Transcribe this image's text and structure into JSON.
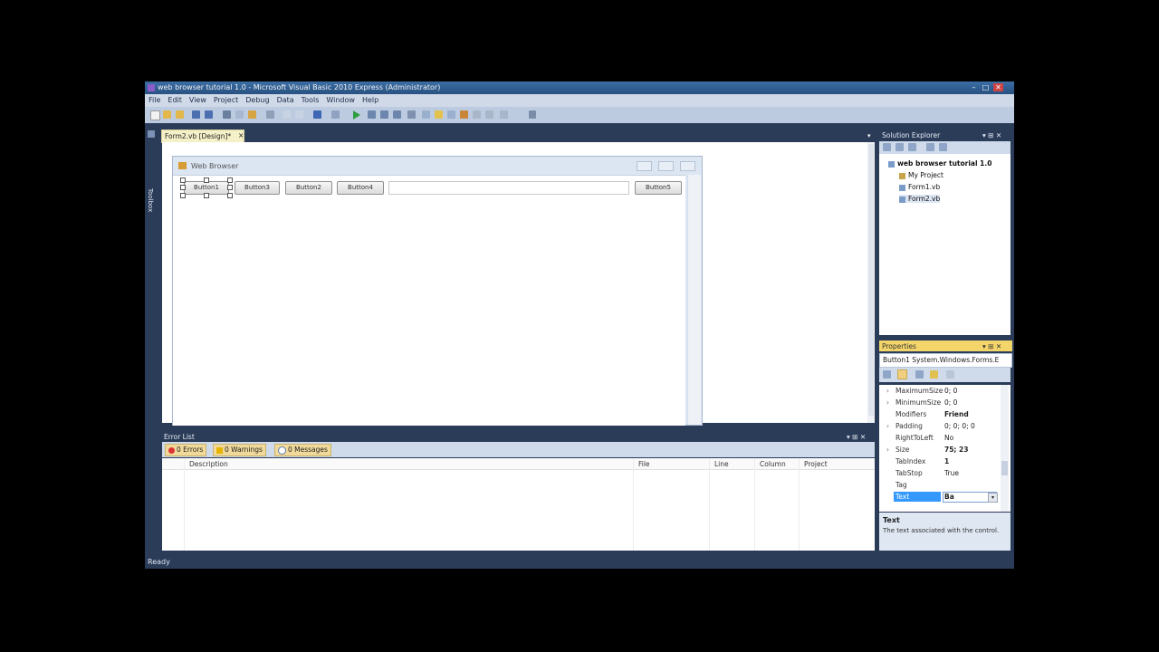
{
  "window": {
    "title": "web browser tutorial 1.0 - Microsoft Visual Basic 2010 Express (Administrator)",
    "minimize": "–",
    "maximize": "□",
    "close": "✕"
  },
  "menu": [
    "File",
    "Edit",
    "View",
    "Project",
    "Debug",
    "Data",
    "Tools",
    "Window",
    "Help"
  ],
  "toolbox": {
    "label": "Toolbox"
  },
  "designer": {
    "tab_label": "Form2.vb [Design]*",
    "tab_close": "×",
    "dropdown": "▾",
    "form": {
      "caption": "Web Browser",
      "buttons": [
        "Button1",
        "Button3",
        "Button2",
        "Button4",
        "Button5"
      ]
    }
  },
  "solution_explorer": {
    "title": "Solution Explorer",
    "pin": "▾ ⊞ ✕",
    "solution": "web browser tutorial 1.0",
    "items": [
      "My Project",
      "Form1.vb",
      "Form2.vb"
    ]
  },
  "properties": {
    "title": "Properties",
    "pin": "▾ ⊞ ✕",
    "object": "Button1 System.Windows.Forms.E",
    "rows": [
      {
        "name": "MaximumSize",
        "value": "0; 0",
        "expandable": true
      },
      {
        "name": "MinimumSize",
        "value": "0; 0",
        "expandable": true
      },
      {
        "name": "Modifiers",
        "value": "Friend",
        "bold": true
      },
      {
        "name": "Padding",
        "value": "0; 0; 0; 0",
        "expandable": true
      },
      {
        "name": "RightToLeft",
        "value": "No"
      },
      {
        "name": "Size",
        "value": "75; 23",
        "expandable": true,
        "bold": true
      },
      {
        "name": "TabIndex",
        "value": "1",
        "bold": true
      },
      {
        "name": "TabStop",
        "value": "True"
      },
      {
        "name": "Tag",
        "value": ""
      },
      {
        "name": "Text",
        "value": "Ba",
        "selected": true
      }
    ],
    "description": {
      "title": "Text",
      "text": "The text associated with the control."
    }
  },
  "error_list": {
    "title": "Error List",
    "pin": "▾ ⊞ ✕",
    "errors": "0 Errors",
    "warnings": "0 Warnings",
    "messages": "0 Messages",
    "columns": [
      "Description",
      "File",
      "Line",
      "Column",
      "Project"
    ]
  },
  "status": {
    "text": "Ready"
  },
  "colors": {
    "ide_background": "#2b3c59",
    "selection": "#3399ff",
    "tab_highlight": "#f4f0c8",
    "properties_header": "#f4d56a"
  }
}
